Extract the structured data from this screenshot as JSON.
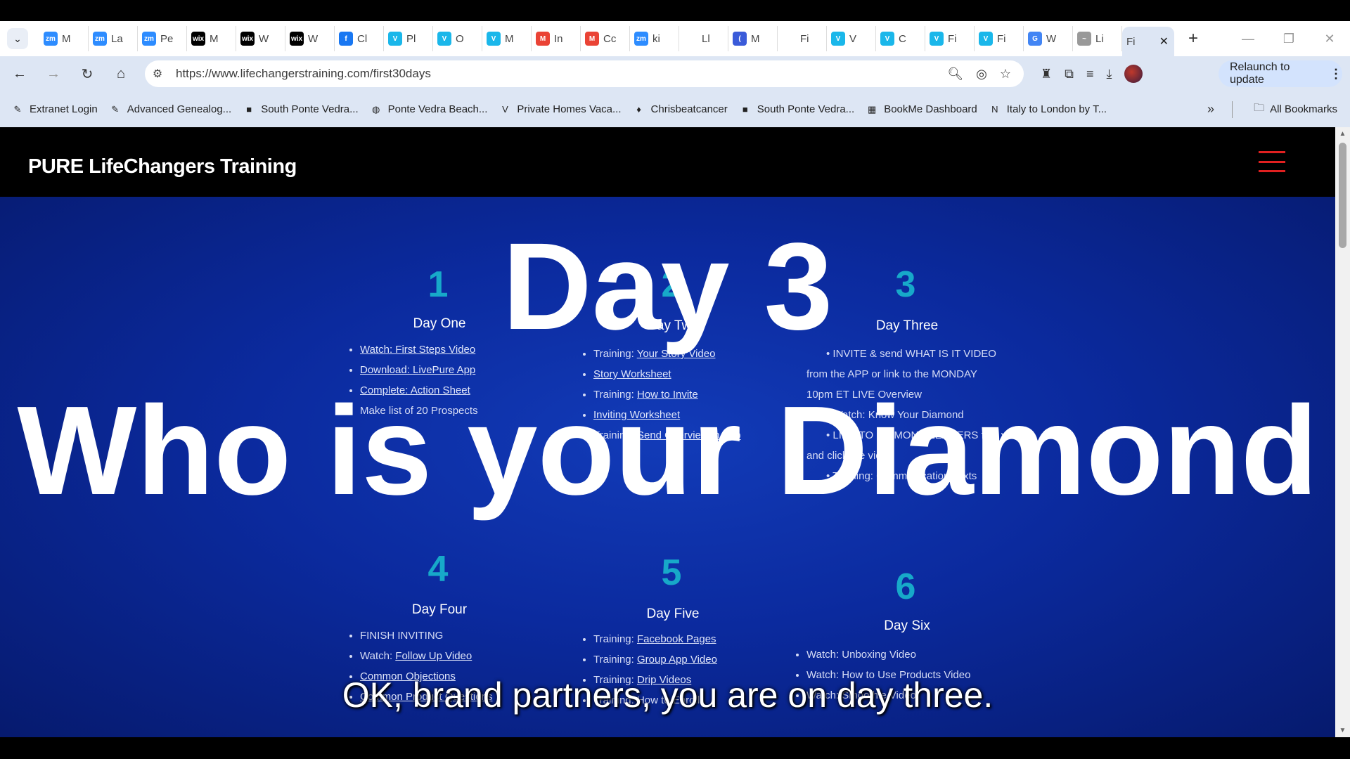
{
  "browser": {
    "tabs": [
      {
        "fav": "zm",
        "label": "M",
        "color": "#2d8cff"
      },
      {
        "fav": "zm",
        "label": "La",
        "color": "#2d8cff"
      },
      {
        "fav": "zm",
        "label": "Pe",
        "color": "#2d8cff"
      },
      {
        "fav": "wix",
        "label": "M",
        "color": "#000000"
      },
      {
        "fav": "wix",
        "label": "W",
        "color": "#000000"
      },
      {
        "fav": "wix",
        "label": "W",
        "color": "#000000"
      },
      {
        "fav": "f",
        "label": "Cl",
        "color": "#1877f2"
      },
      {
        "fav": "V",
        "label": "Pl",
        "color": "#1ab7ea"
      },
      {
        "fav": "V",
        "label": "O",
        "color": "#1ab7ea"
      },
      {
        "fav": "V",
        "label": "M",
        "color": "#1ab7ea"
      },
      {
        "fav": "M",
        "label": "In",
        "color": "#ea4335"
      },
      {
        "fav": "M",
        "label": "Cc",
        "color": "#ea4335"
      },
      {
        "fav": "zm",
        "label": "ki",
        "color": "#2d8cff"
      },
      {
        "fav": "",
        "label": "Ll",
        "color": "#ffffff"
      },
      {
        "fav": "(",
        "label": "M",
        "color": "#3a5bd9"
      },
      {
        "fav": "",
        "label": "Fi",
        "color": "#ffffff"
      },
      {
        "fav": "V",
        "label": "V",
        "color": "#1ab7ea"
      },
      {
        "fav": "V",
        "label": "C",
        "color": "#1ab7ea"
      },
      {
        "fav": "V",
        "label": "Fi",
        "color": "#1ab7ea"
      },
      {
        "fav": "V",
        "label": "Fi",
        "color": "#1ab7ea"
      },
      {
        "fav": "G",
        "label": "W",
        "color": "#4285f4"
      },
      {
        "fav": "~",
        "label": "Li",
        "color": "#999999"
      }
    ],
    "active_tab": {
      "label": "Fi"
    },
    "url": "https://www.lifechangerstraining.com/first30days",
    "relaunch_label": "Relaunch to update",
    "bookmarks": [
      {
        "icon": "pen-icon",
        "label": "Extranet Login"
      },
      {
        "icon": "pen-icon",
        "label": "Advanced Genealog..."
      },
      {
        "icon": "square-icon",
        "label": "South Ponte Vedra..."
      },
      {
        "icon": "globe-icon",
        "label": "Ponte Vedra Beach..."
      },
      {
        "icon": "v-icon",
        "label": "Private Homes Vaca..."
      },
      {
        "icon": "ribbon-icon",
        "label": "Chrisbeatcancer"
      },
      {
        "icon": "square-icon",
        "label": "South Ponte Vedra..."
      },
      {
        "icon": "grid-icon",
        "label": "BookMe Dashboard"
      },
      {
        "icon": "n-icon",
        "label": "Italy to London by T..."
      }
    ],
    "all_bookmarks_label": "All Bookmarks"
  },
  "site": {
    "title": "PURE LifeChangers Training",
    "accent": "#e02020"
  },
  "days": [
    {
      "num": "1",
      "name": "Day One",
      "items": [
        {
          "prefix": "",
          "link": "Watch: First Steps Video "
        },
        {
          "prefix": "",
          "link": "Download: LivePure App"
        },
        {
          "prefix": "",
          "link": "Complete: Action Sheet"
        },
        {
          "prefix": "Make list of 20 Prospects",
          "link": ""
        }
      ]
    },
    {
      "num": "2",
      "name": "Day Two",
      "items": [
        {
          "prefix": "Training: ",
          "link": "Your Story Video"
        },
        {
          "prefix": " ",
          "link": "Story Worksheet"
        },
        {
          "prefix": "Training: ",
          "link": "How to Invite "
        },
        {
          "prefix": "",
          "link": "Inviting Worksheet"
        },
        {
          "prefix": "Training: ",
          "link": "Send Overview in App"
        }
      ]
    },
    {
      "num": "3",
      "name": "Day Three",
      "lines": [
        "• INVITE & send WHAT IS IT VIDEO",
        "from the APP or link to the MONDAY",
        "10pm ET LIVE Overview ",
        "• Watch: Know Your Diamond",
        "• LINK TO DIAMOND LEADERS find y",
        "and click the video",
        "• Training: Communication Texts"
      ]
    },
    {
      "num": "4",
      "name": "Day Four",
      "items": [
        {
          "prefix": "FINISH INVITING",
          "link": ""
        },
        {
          "prefix": "Watch: ",
          "link": "Follow Up Video"
        },
        {
          "prefix": "",
          "link": "Common Objections"
        },
        {
          "prefix": "",
          "link": "Common Product Questions"
        }
      ]
    },
    {
      "num": "5",
      "name": "Day Five",
      "items": [
        {
          "prefix": "Training: ",
          "link": "Facebook Pages"
        },
        {
          "prefix": "Training: ",
          "link": "Group App Video"
        },
        {
          "prefix": "Training: ",
          "link": "Drip Videos"
        },
        {
          "prefix": "Training: How to Enroll",
          "link": ""
        }
      ]
    },
    {
      "num": "6",
      "name": "Day Six",
      "items": [
        {
          "prefix": "Watch: Unboxing Video",
          "link": ""
        },
        {
          "prefix": "Watch: How to Use Products Video",
          "link": ""
        },
        {
          "prefix": "Watch: Smoothie Video",
          "link": ""
        }
      ]
    }
  ],
  "overlay": {
    "line1": "Day 3",
    "line2": "Who is your Diamond"
  },
  "caption": "OK, brand partners, you are on day three."
}
